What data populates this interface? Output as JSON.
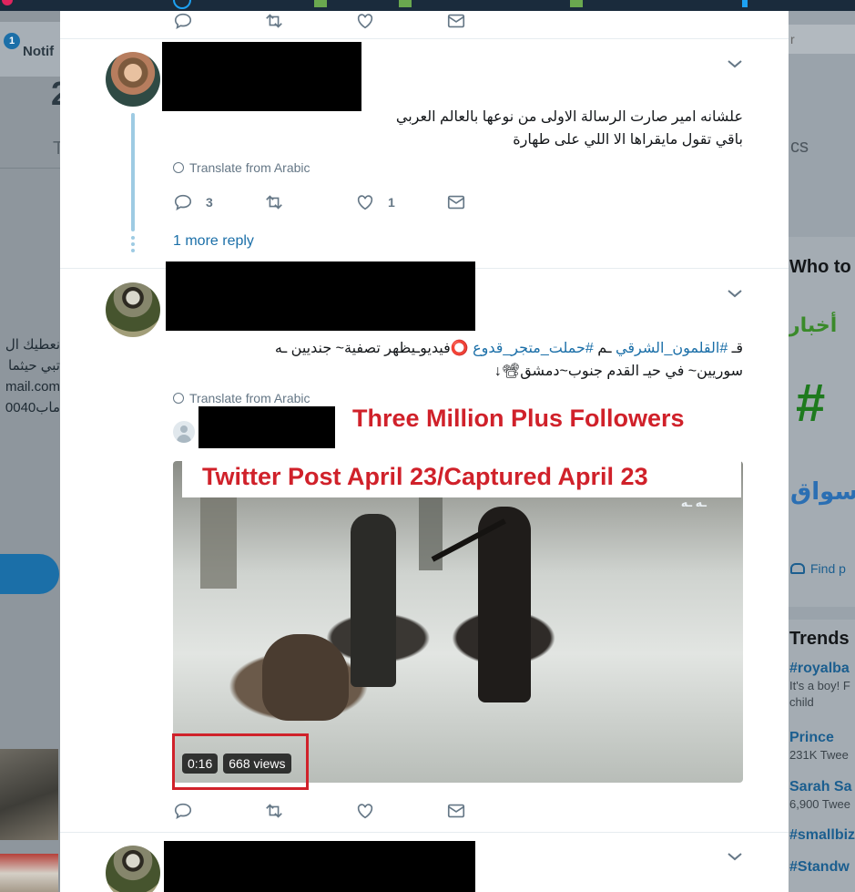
{
  "left": {
    "notifications_badge": "1",
    "notifications_label": "Notif",
    "stat_partial": "2",
    "tab_partial": "T",
    "rtl_lines": [
      "نعطيك ال",
      "تبي حيثما",
      "mail.com",
      "ماب0040"
    ]
  },
  "right": {
    "search_placeholder": "r",
    "profile_partial": "cs",
    "who_to_follow": "Who to",
    "avatar_a_text": "أخبار",
    "avatar_b_text": "سواق",
    "find_people": "Find p",
    "trends_title": "Trends",
    "trends": [
      {
        "name": "#royalba",
        "meta": "It's a boy! F",
        "meta2": "child"
      },
      {
        "name": "Prince",
        "meta": "231K Twee"
      },
      {
        "name": "Sarah Sa",
        "meta": "6,900 Twee"
      },
      {
        "name": "#smallbiz",
        "meta": ""
      },
      {
        "name": "#Standw",
        "meta": ""
      }
    ]
  },
  "tweet1": {
    "text_line1": "علشانه امير صارت الرسالة الاولى من نوعها بالعالم العربي",
    "text_line2": "باقي تقول مايقراها الا اللي على طهارة",
    "translate": "Translate from Arabic",
    "reply_count": "3",
    "retweet_count": "",
    "like_count": "1",
    "more_reply": "1 more reply"
  },
  "tweet2": {
    "text_line1_plain_a": "قـ ",
    "hashtag1": "#القلمون_الشرقي",
    "text_line1_plain_b": " ـم ",
    "hashtag2": "#حملت_متجر_قدوع",
    "text_line1_plain_c": " ⭕فيديوـيظهر تصفية~ جنديين ـه",
    "text_line2": "سوريين~ في حيـ القدم جنوب~دمشق📽↓",
    "translate": "Translate from Arabic",
    "annotation_followers": "Three Million Plus Followers",
    "annotation_caption": "Twitter Post April 23/Captured April 23",
    "video_duration": "0:16",
    "video_views": "668 views",
    "video_logo": "ـه ـه"
  },
  "colors": {
    "accent": "#1b6fa8",
    "annotation_red": "#d0212a",
    "muted": "#657786"
  }
}
